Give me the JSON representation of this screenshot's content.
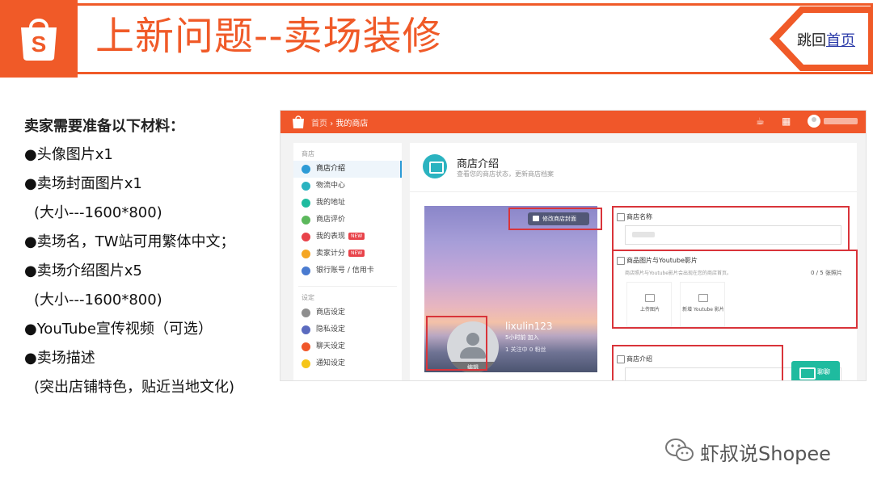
{
  "header": {
    "title": "上新问题--卖场装修",
    "jump_prefix": "跳回",
    "jump_link": "首页",
    "logo_letter": "S",
    "brand_color": "#f05a28"
  },
  "materials": {
    "heading": "卖家需要准备以下材料：",
    "items": [
      "●头像图片x1",
      "●卖场封面图片x1",
      "(大小---1600*800)",
      "●卖场名，TW站可用繁体中文；",
      "●卖场介绍图片x5",
      "(大小---1600*800)",
      "●YouTube宣传视频（可选）",
      "●卖场描述",
      "(突出店铺特色，贴近当地文化)"
    ]
  },
  "shot": {
    "topbar": {
      "crumb_home": "首页",
      "crumb_sep": "›",
      "crumb_current": "我的商店",
      "icons": [
        "bell-icon",
        "apps-grid-icon",
        "user-avatar-icon"
      ],
      "accent": "#f0572a"
    },
    "sidebar": {
      "section1": "商店",
      "items1": [
        {
          "label": "商店介绍",
          "icon": "shop-icon",
          "color": "#2d9bd6",
          "active": true,
          "tag": ""
        },
        {
          "label": "物流中心",
          "icon": "truck-icon",
          "color": "#2bb3c0",
          "active": false,
          "tag": ""
        },
        {
          "label": "我的地址",
          "icon": "location-icon",
          "color": "#1fbb9f",
          "active": false,
          "tag": ""
        },
        {
          "label": "商店评价",
          "icon": "star-icon",
          "color": "#5cb85c",
          "active": false,
          "tag": ""
        },
        {
          "label": "我的表现",
          "icon": "chart-icon",
          "color": "#e8434a",
          "active": false,
          "tag": "NEW"
        },
        {
          "label": "卖家计分",
          "icon": "score-icon",
          "color": "#f5a623",
          "active": false,
          "tag": "NEW"
        },
        {
          "label": "银行账号 / 信用卡",
          "icon": "bank-card-icon",
          "color": "#4a7bd0",
          "active": false,
          "tag": ""
        }
      ],
      "section2": "设定",
      "items2": [
        {
          "label": "商店设定",
          "icon": "gear-icon",
          "color": "#8e8e8e",
          "active": false,
          "tag": ""
        },
        {
          "label": "隐私设定",
          "icon": "lock-icon",
          "color": "#5b6bbf",
          "active": false,
          "tag": ""
        },
        {
          "label": "聊天设定",
          "icon": "chat-icon",
          "color": "#f0572a",
          "active": false,
          "tag": ""
        },
        {
          "label": "通知设定",
          "icon": "bell-icon",
          "color": "#f5c518",
          "active": false,
          "tag": ""
        }
      ]
    },
    "main": {
      "title": "商店介绍",
      "subtitle": "查看您的商店状态，更新商店档案",
      "cover_button": "修改商店封面",
      "shop_name": "lixulin123",
      "joined": "5小时前 加入",
      "stats": "1 关注中   0 粉丝",
      "avatar_edit": "编辑",
      "field_name_label": "商店名称",
      "field_media_label": "商品图片与Youtube影片",
      "field_media_hint": "商店照片与Youtube影片会出现在您的商店首页。",
      "field_media_count": "0 / 5 张照片",
      "upload_image": "上传图片",
      "add_youtube": "新增 Youtube 影片",
      "field_intro_label": "商店介绍",
      "chat_button": "聊聊"
    },
    "highlight_color": "#d9343a"
  },
  "watermark": {
    "text": "虾叔说Shopee",
    "icon": "wechat-icon"
  }
}
